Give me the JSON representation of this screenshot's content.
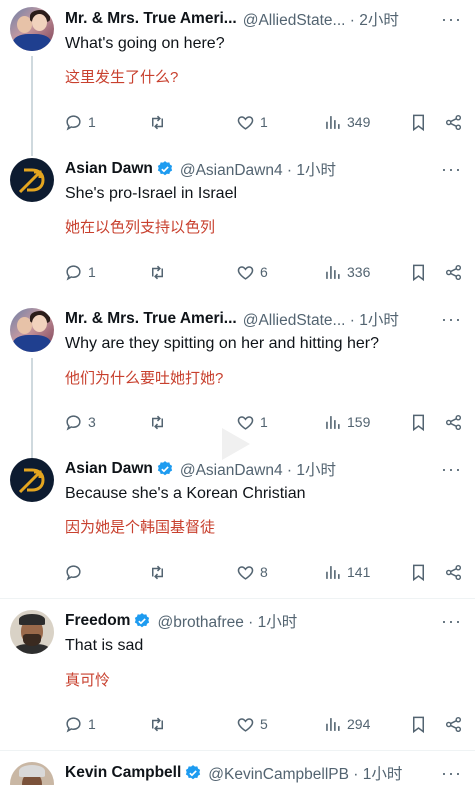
{
  "tweets": [
    {
      "name": "Mr. & Mrs. True Ameri...",
      "handle_time": "@AlliedState... · 2小时",
      "verified": false,
      "text": "What's going on here?",
      "translation": "这里发生了什么?",
      "replies": "1",
      "retweets": "",
      "likes": "1",
      "views": "349"
    },
    {
      "name": "Asian Dawn",
      "handle_time": "@AsianDawn4 · 1小时",
      "verified": true,
      "text": "She's pro-Israel in Israel",
      "translation": "她在以色列支持以色列",
      "replies": "1",
      "retweets": "",
      "likes": "6",
      "views": "336"
    },
    {
      "name": "Mr. & Mrs. True Ameri...",
      "handle_time": "@AlliedState... · 1小时",
      "verified": false,
      "text": "Why are they spitting on her and hitting her?",
      "translation": "他们为什么要吐她打她?",
      "replies": "3",
      "retweets": "",
      "likes": "1",
      "views": "159"
    },
    {
      "name": "Asian Dawn",
      "handle_time": "@AsianDawn4 · 1小时",
      "verified": true,
      "text": "Because she's a Korean Christian",
      "translation": "因为她是个韩国基督徒",
      "replies": "",
      "retweets": "",
      "likes": "8",
      "views": "141"
    },
    {
      "name": "Freedom",
      "handle_time": "@brothafree · 1小时",
      "verified": true,
      "text": "That is sad",
      "translation": "真可怜",
      "replies": "1",
      "retweets": "",
      "likes": "5",
      "views": "294"
    },
    {
      "name": "Kevin Campbell",
      "handle_time": "@KevinCampbellPB · 1小时",
      "verified": true
    }
  ],
  "icons": {
    "reply": "reply-icon",
    "retweet": "retweet-icon",
    "like": "heart-icon",
    "views": "views-icon",
    "bookmark": "bookmark-icon",
    "share": "share-icon",
    "more": "more-icon",
    "verified": "verified-badge-icon"
  },
  "colors": {
    "accent": "#1d9bf0",
    "translation": "#c8402e",
    "muted": "#536471"
  }
}
